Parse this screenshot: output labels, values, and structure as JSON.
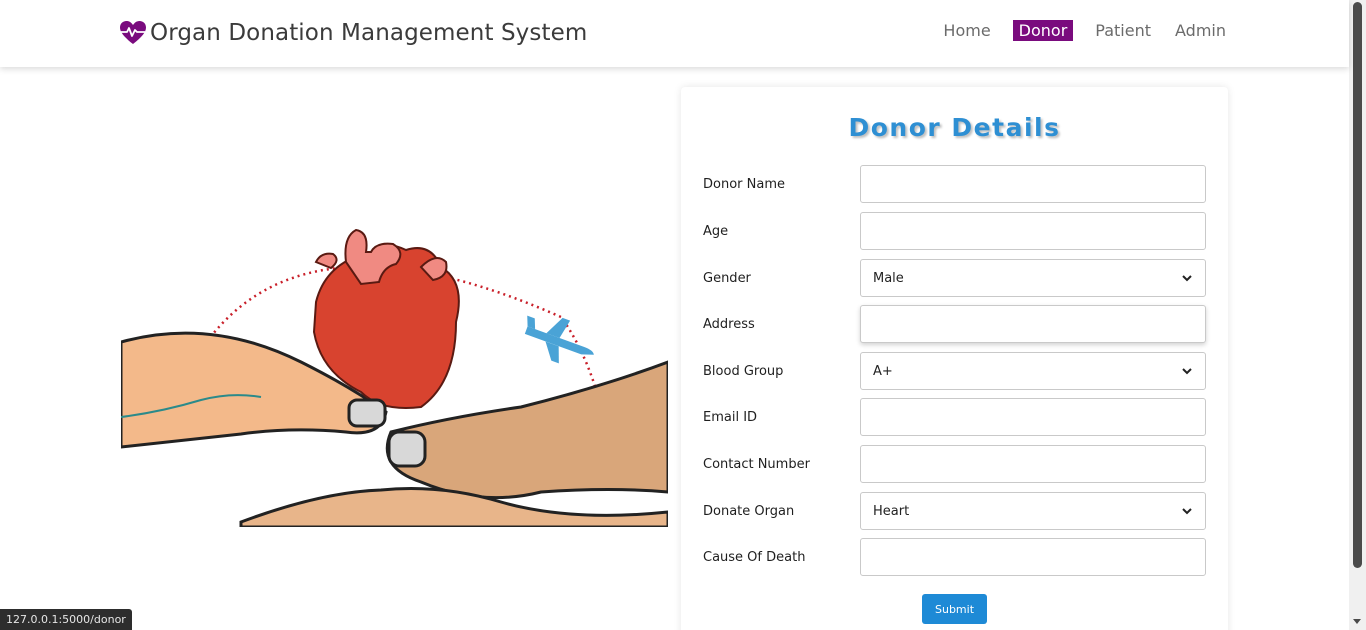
{
  "brand": {
    "title": "Organ Donation Management System",
    "logo_icon": "heartbeat-icon",
    "logo_color": "#7a0b7e"
  },
  "nav": {
    "items": [
      {
        "label": "Home"
      },
      {
        "label": "Donor"
      },
      {
        "label": "Patient"
      },
      {
        "label": "Admin"
      }
    ],
    "active": "Donor",
    "active_color": "#7a0b7e"
  },
  "hero": {
    "image": "hands-holding-heart-illustration"
  },
  "form": {
    "title": "Donor Details",
    "title_color": "#2e8fd3",
    "fields": [
      {
        "label": "Donor Name",
        "type": "text",
        "value": ""
      },
      {
        "label": "Age",
        "type": "text",
        "value": ""
      },
      {
        "label": "Gender",
        "type": "select",
        "value": "Male"
      },
      {
        "label": "Address",
        "type": "text",
        "value": ""
      },
      {
        "label": "Blood Group",
        "type": "select",
        "value": "A+"
      },
      {
        "label": "Email ID",
        "type": "text",
        "value": ""
      },
      {
        "label": "Contact Number",
        "type": "text",
        "value": ""
      },
      {
        "label": "Donate Organ",
        "type": "select",
        "value": "Heart"
      },
      {
        "label": "Cause Of Death",
        "type": "text",
        "value": ""
      }
    ],
    "submit_label": "Submit",
    "submit_color": "#1e8ad6"
  },
  "status_url": "127.0.0.1:5000/donor"
}
